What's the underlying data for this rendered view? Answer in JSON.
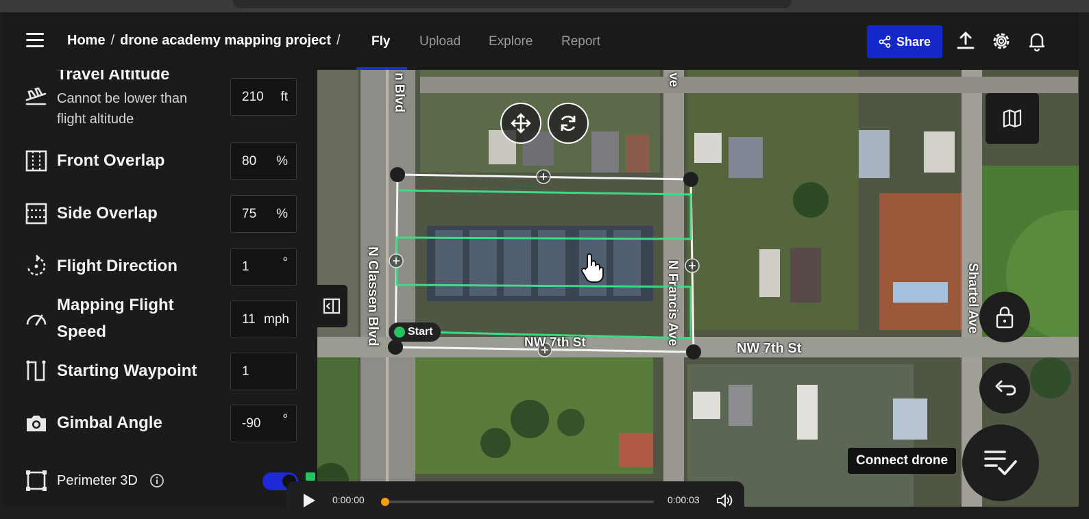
{
  "header": {
    "breadcrumb_home": "Home",
    "breadcrumb_sep1": "/",
    "breadcrumb_project": "drone academy mapping project",
    "breadcrumb_sep2": "/",
    "tabs": [
      {
        "label": "Fly",
        "active": true
      },
      {
        "label": "Upload",
        "active": false
      },
      {
        "label": "Explore",
        "active": false
      },
      {
        "label": "Report",
        "active": false
      }
    ],
    "share_label": "Share",
    "accent_color": "#1427c9",
    "icons": [
      "menu-icon",
      "share-icon",
      "upload-icon",
      "gear-icon",
      "bell-icon"
    ]
  },
  "settings": {
    "travel_altitude": {
      "label": "Travel Altitude",
      "sub1": "Cannot be lower than",
      "sub2": "flight altitude",
      "value": "210",
      "unit": "ft",
      "icon": "plane-takeoff-icon"
    },
    "front_overlap": {
      "label": "Front Overlap",
      "value": "80",
      "unit": "%",
      "icon": "front-overlap-icon"
    },
    "side_overlap": {
      "label": "Side Overlap",
      "value": "75",
      "unit": "%",
      "icon": "side-overlap-icon"
    },
    "flight_direction": {
      "label": "Flight Direction",
      "value": "1",
      "unit": "°",
      "icon": "rotate-icon"
    },
    "mapping_speed": {
      "label1": "Mapping Flight",
      "label2": "Speed",
      "value": "11",
      "unit": "mph",
      "icon": "speedometer-icon"
    },
    "starting_waypoint": {
      "label": "Starting Waypoint",
      "value": "1",
      "icon": "waypoint-icon"
    },
    "gimbal_angle": {
      "label": "Gimbal Angle",
      "value": "-90",
      "unit": "°",
      "icon": "camera-icon"
    },
    "perimeter_3d": {
      "label": "Perimeter 3D",
      "enabled": true,
      "icon": "square-icon",
      "info_icon": "info-icon"
    }
  },
  "map": {
    "streets": {
      "classen": "N Classen Blvd",
      "classen_top": "n Blvd",
      "francis": "N Francis Ave",
      "francis_top": "ve",
      "nw7_left": "NW 7th St",
      "nw7_right": "NW 7th St",
      "shartel": "Shartel Ave"
    },
    "start_label": "Start",
    "connect_label": "Connect drone",
    "flight_path_color": "#3ddc84",
    "icons": [
      "move-icon",
      "rotate-icon",
      "map-layers-icon",
      "lock-icon",
      "undo-icon",
      "checklist-icon",
      "collapse-panel-icon",
      "hand-cursor-icon"
    ]
  },
  "player": {
    "current": "0:00:00",
    "total": "0:00:03",
    "progress": 0.0,
    "icons": [
      "play-icon",
      "volume-icon"
    ]
  }
}
